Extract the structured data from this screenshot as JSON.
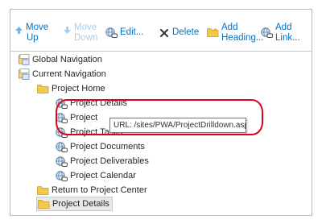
{
  "toolbar": {
    "move_up": "Move Up",
    "move_up_l1": "Move",
    "move_up_l2": "Up",
    "move_down_l1": "Move",
    "move_down_l2": "Down",
    "edit": "Edit...",
    "delete": "Delete",
    "add_heading_l1": "Add",
    "add_heading_l2": "Heading...",
    "add_link_l1": "Add",
    "add_link_l2": "Link..."
  },
  "tree": {
    "global_navigation": "Global Navigation",
    "current_navigation": "Current Navigation",
    "project_home": "Project Home",
    "project_details": "Project Details",
    "project_truncated": "Project",
    "project_tasks": "Project Tasks",
    "project_documents": "Project Documents",
    "project_deliverables": "Project Deliverables",
    "project_calendar": "Project Calendar",
    "return_to_project_center": "Return to Project Center",
    "project_details_selected": "Project Details"
  },
  "tooltip": {
    "text": "URL: /sites/PWA/ProjectDrilldown.aspx"
  },
  "colors": {
    "link_blue": "#0072c6",
    "disabled_blue": "#a6cfee",
    "highlight_red": "#e2001a",
    "folder_yellow": "#f2c94c",
    "selected_bg": "#e8e8e8"
  },
  "icons": [
    "arrow-up-icon",
    "arrow-down-icon",
    "globe-link-icon",
    "close-icon",
    "folder-icon",
    "navigation-icon"
  ]
}
